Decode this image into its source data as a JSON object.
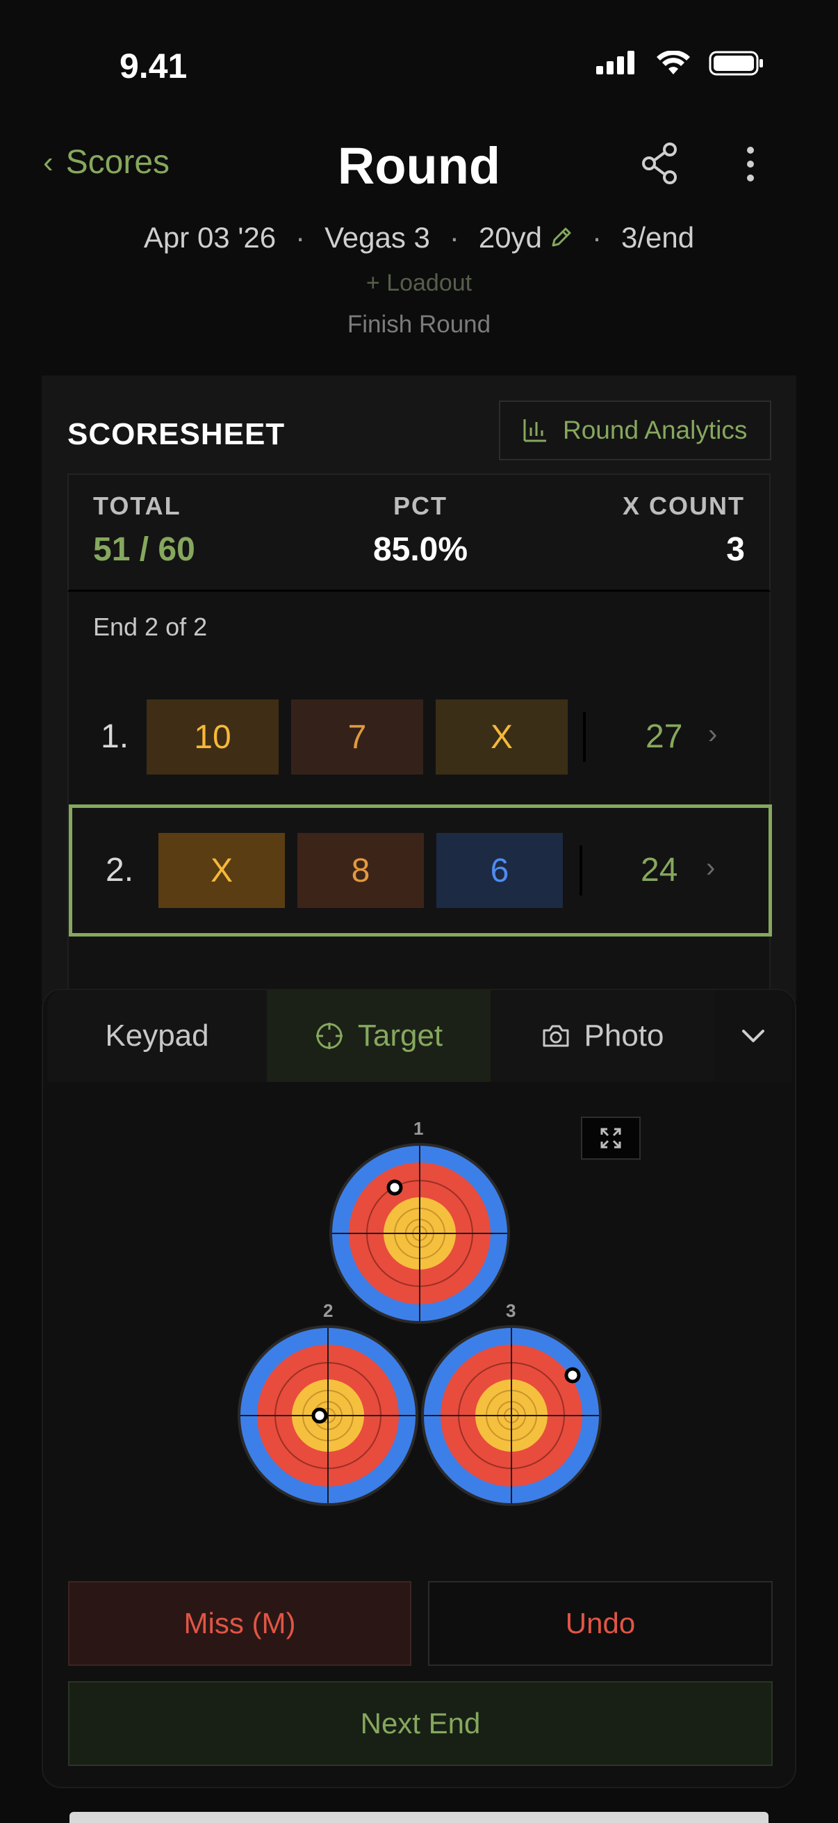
{
  "status_bar": {
    "time": "9.41"
  },
  "header": {
    "back_label": "Scores",
    "title": "Round"
  },
  "meta": {
    "date": "Apr 03 '26",
    "round_type": "Vegas 3",
    "distance": "20yd",
    "per_end": "3/end",
    "separator": "·"
  },
  "loadout_label": "+ Loadout",
  "finish_label": "Finish Round",
  "scoresheet": {
    "title": "SCORESHEET",
    "analytics_label": "Round Analytics",
    "summary": {
      "total_label": "TOTAL",
      "total_value": "51 / 60",
      "pct_label": "PCT",
      "pct_value": "85.0%",
      "x_label": "X COUNT",
      "x_value": "3"
    },
    "end_label": "End 2 of 2",
    "ends": [
      {
        "num": "1.",
        "arrows": [
          "10",
          "7",
          "X"
        ],
        "total": "27"
      },
      {
        "num": "2.",
        "arrows": [
          "X",
          "8",
          "6"
        ],
        "total": "24"
      }
    ]
  },
  "input": {
    "tabs": [
      "Keypad",
      "Target",
      "Photo"
    ],
    "active_tab": "Target",
    "face_labels": [
      "1",
      "2",
      "3"
    ],
    "miss_label": "Miss (M)",
    "undo_label": "Undo",
    "next_label": "Next End"
  },
  "colors": {
    "accent": "#86a85e",
    "danger": "#e25545",
    "gold": "#f5c03e",
    "red": "#e84c3d",
    "blue": "#3d7fe8"
  }
}
